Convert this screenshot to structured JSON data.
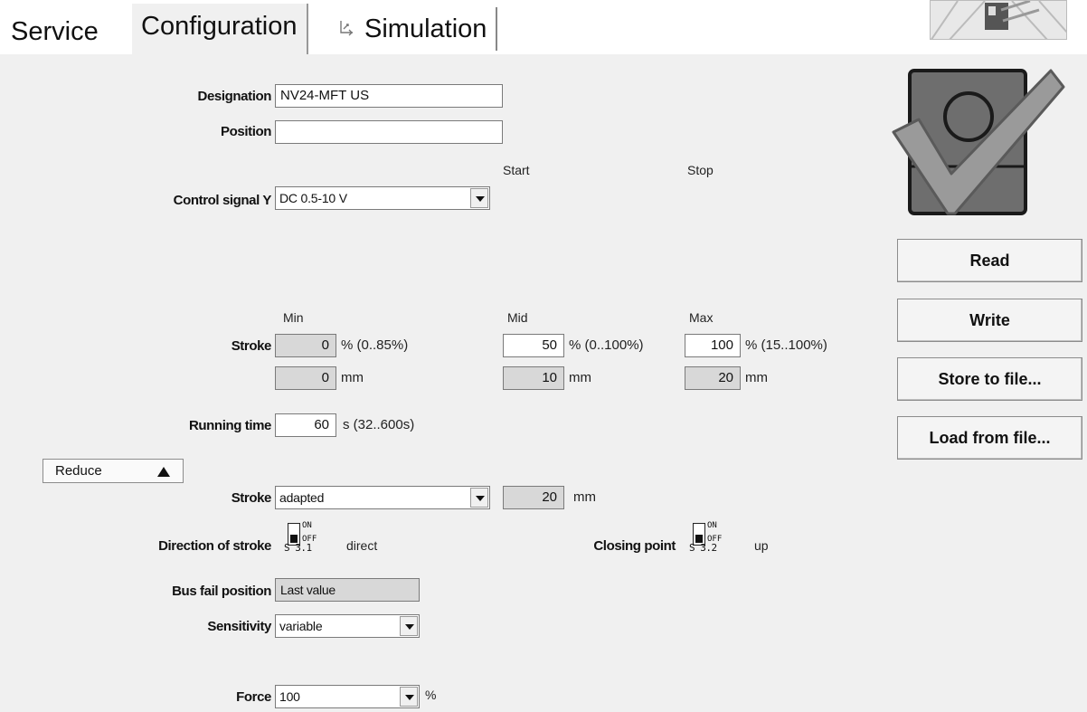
{
  "tabs": {
    "service": "Service",
    "configuration": "Configuration",
    "simulation": "Simulation"
  },
  "form": {
    "designation": {
      "label": "Designation",
      "value": "NV24-MFT US"
    },
    "position": {
      "label": "Position",
      "value": ""
    },
    "start_label": "Start",
    "stop_label": "Stop",
    "control_signal": {
      "label": "Control signal Y",
      "value": "DC 0.5-10 V"
    },
    "stroke": {
      "label": "Stroke",
      "min_label": "Min",
      "mid_label": "Mid",
      "max_label": "Max",
      "min_pct": "0",
      "min_range": "% (0..85%)",
      "mid_pct": "50",
      "mid_range": "% (0..100%)",
      "max_pct": "100",
      "max_range": "% (15..100%)",
      "min_mm": "0",
      "mid_mm": "10",
      "max_mm": "20",
      "mm_unit": "mm"
    },
    "running_time": {
      "label": "Running time",
      "value": "60",
      "unit": "s  (32..600s)"
    },
    "reduce_label": "Reduce",
    "stroke_mode": {
      "label": "Stroke",
      "value": "adapted",
      "mm_value": "20",
      "mm_unit": "mm"
    },
    "direction": {
      "label": "Direction of stroke",
      "switch_on": "ON",
      "switch_off": "OFF",
      "switch_code": "S 3.1",
      "value": "direct"
    },
    "closing_point": {
      "label": "Closing point",
      "switch_on": "ON",
      "switch_off": "OFF",
      "switch_code": "S 3.2",
      "value": "up"
    },
    "bus_fail": {
      "label": "Bus fail position",
      "value": "Last value"
    },
    "sensitivity": {
      "label": "Sensitivity",
      "value": "variable"
    },
    "force": {
      "label": "Force",
      "value": "100",
      "unit": "%"
    }
  },
  "buttons": {
    "read": "Read",
    "write": "Write",
    "store": "Store to file...",
    "load": "Load from file..."
  },
  "colors": {
    "panel_bg": "#f0f0f0",
    "field_disabled": "#d8d8d8",
    "device_body": "#6e6e6e",
    "check_fill": "#9a9a9a"
  }
}
